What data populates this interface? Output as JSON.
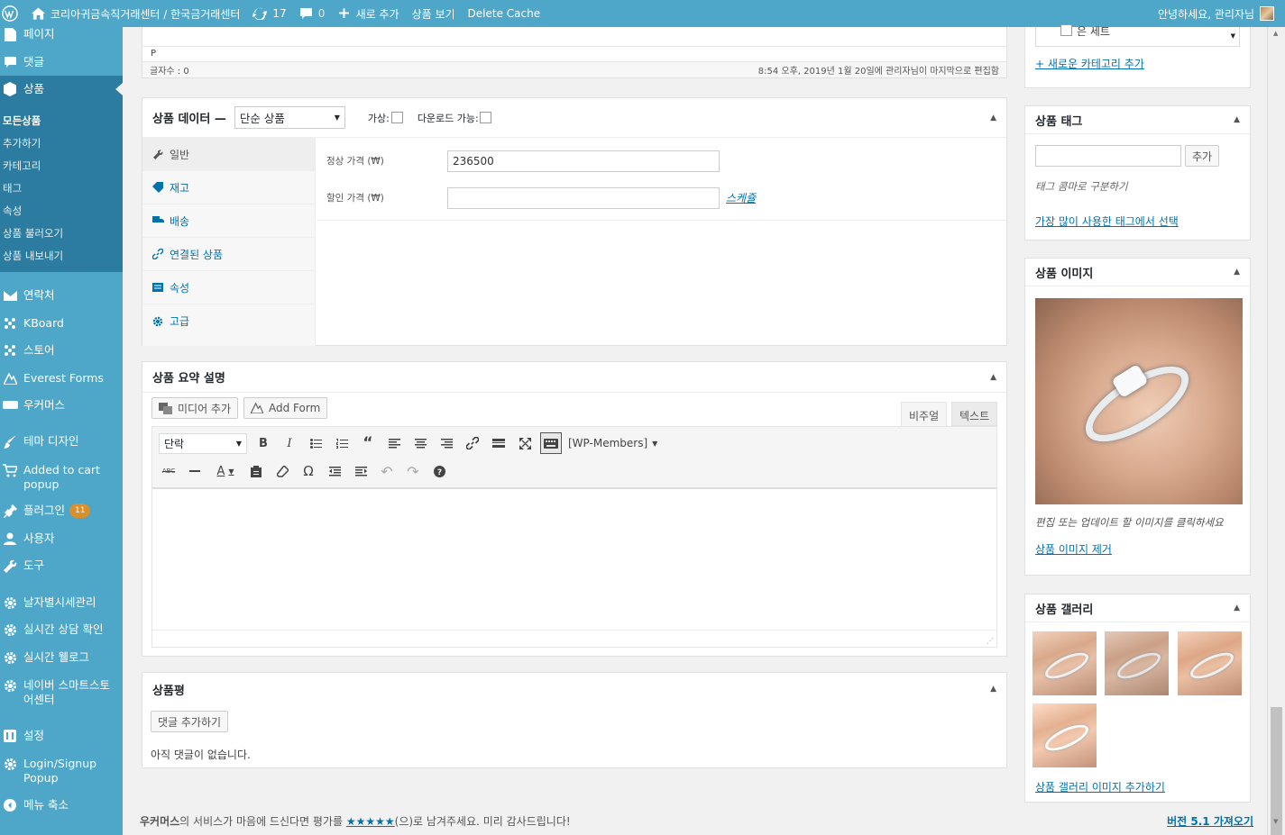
{
  "adminbar": {
    "site_title": "코리아귀금속직거래센터 / 한국금거래센터",
    "updates_count": "17",
    "comments_count": "0",
    "new_label": "새로 추가",
    "view_label": "상품 보기",
    "cache_label": "Delete Cache",
    "greeting": "안녕하세요, 관리자님"
  },
  "sidebar": {
    "top_items": [
      {
        "label": "페이지",
        "icon": "page-icon"
      },
      {
        "label": "댓글",
        "icon": "comment-icon"
      }
    ],
    "current": {
      "label": "상품",
      "icon": "product-icon"
    },
    "submenu": [
      "모든상품",
      "추가하기",
      "카테고리",
      "태그",
      "속성",
      "상품 불러오기",
      "상품 내보내기"
    ],
    "items": [
      {
        "label": "연락처",
        "icon": "mail-icon"
      },
      {
        "label": "KBoard",
        "icon": "kboard-icon"
      },
      {
        "label": "스토어",
        "icon": "store-icon"
      },
      {
        "label": "Everest Forms",
        "icon": "everest-icon"
      },
      {
        "label": "우커머스",
        "icon": "woo-icon"
      },
      {
        "label": "테마 디자인",
        "icon": "brush-icon"
      },
      {
        "label": "Added to cart popup",
        "icon": "cart-icon"
      },
      {
        "label": "플러그인",
        "icon": "plugin-icon",
        "badge": "11"
      },
      {
        "label": "사용자",
        "icon": "user-icon"
      },
      {
        "label": "도구",
        "icon": "wrench-icon"
      },
      {
        "label": "날자별시세관리",
        "icon": "gear-icon"
      },
      {
        "label": "실시간 상담 확인",
        "icon": "gear-icon"
      },
      {
        "label": "실시간 웰로그",
        "icon": "gear-icon"
      },
      {
        "label": "네이버 스마트스토어센터",
        "icon": "gear-icon"
      },
      {
        "label": "설정",
        "icon": "settings-icon"
      },
      {
        "label": "Login/Signup Popup",
        "icon": "gear-icon"
      },
      {
        "label": "메뉴 축소",
        "icon": "collapse-icon"
      }
    ]
  },
  "editor_top": {
    "path": "P",
    "word_count": "글자수 : 0",
    "last_edited": "8:54 오후, 2019년 1월 20일에 관리자님이 마지막으로 편집함"
  },
  "product_data": {
    "title": "상품 데이터 —",
    "type_selected": "단순 상품",
    "virtual_label": "가상:",
    "download_label": "다운로드 가능:",
    "tabs": [
      {
        "label": "일반",
        "icon": "wrench-icon"
      },
      {
        "label": "재고",
        "icon": "tag-icon"
      },
      {
        "label": "배송",
        "icon": "truck-icon"
      },
      {
        "label": "연결된 상품",
        "icon": "link-icon"
      },
      {
        "label": "속성",
        "icon": "list-icon"
      },
      {
        "label": "고급",
        "icon": "gear-icon"
      }
    ],
    "regular_price_label": "정상 가격 (₩)",
    "regular_price_value": "236500",
    "sale_price_label": "할인 가격 (₩)",
    "sale_price_value": "",
    "schedule_link": "스케쥴"
  },
  "short_desc": {
    "title": "상품 요약 설명",
    "add_media": "미디어 추가",
    "add_form": "Add Form",
    "tab_visual": "비주얼",
    "tab_text": "텍스트",
    "format_selected": "단락",
    "wp_members": "[WP-Members]"
  },
  "reviews": {
    "title": "상품평",
    "add_comment": "댓글 추가하기",
    "no_comments": "아직 댓글이 없습니다."
  },
  "right": {
    "category_partial": "은 세트",
    "add_category_link": "+ 새로운 카테고리 추가",
    "tags_title": "상품 태그",
    "tags_add": "추가",
    "tags_hint": "태그 콤마로 구분하기",
    "tags_popular": "가장 많이 사용한 태그에서 선택",
    "image_title": "상품 이미지",
    "image_hint": "편집 또는 업데이트 할 이미지를 클릭하세요",
    "image_remove": "상품 이미지 제거",
    "gallery_title": "상품 갤러리",
    "gallery_add": "상품 갤러리 이미지 추가하기"
  },
  "footer": {
    "rate_prefix": "우커머스",
    "rate_mid": "의 서비스가 마음에 드신다면 평가를 ",
    "stars": "★★★★★",
    "rate_suffix": "(으)로 남겨주세요. 미리 감사드립니다!",
    "version": "버전 5.1 가져오기"
  }
}
